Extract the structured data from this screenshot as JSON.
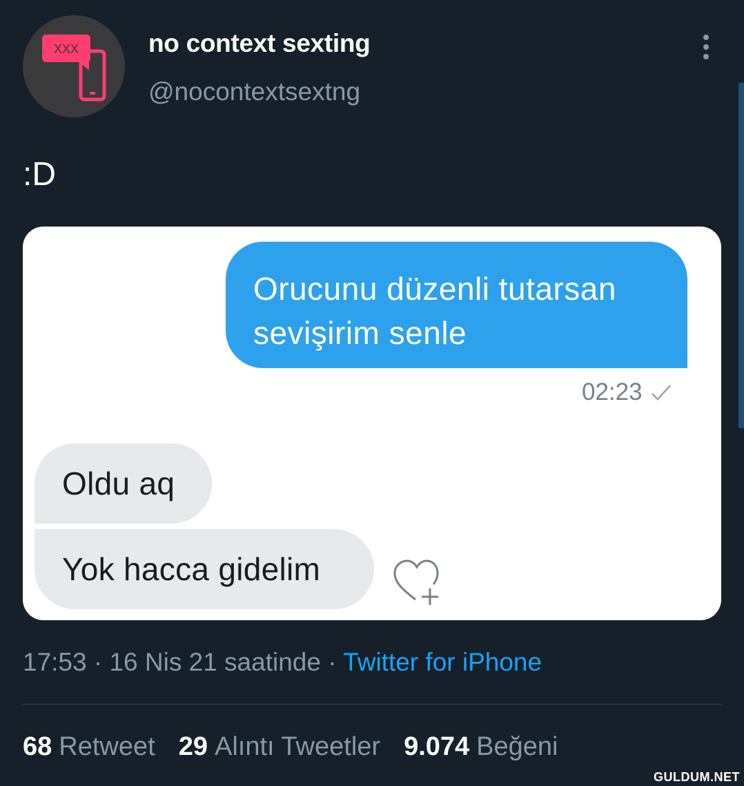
{
  "profile": {
    "avatar_badge_text": "XXX",
    "display_name": "no context sexting",
    "handle": "@nocontextsextng"
  },
  "tweet": {
    "text": ":D",
    "media": {
      "outgoing_message_line1": "Orucunu düzenli tutarsan",
      "outgoing_message_line2": "sevişirim senle",
      "outgoing_time": "02:23",
      "incoming_messages": [
        "Oldu aq",
        "Yok hacca gidelim"
      ]
    },
    "timestamp": "17:53 · 16 Nis 21 saatinde · ",
    "source": "Twitter for iPhone"
  },
  "stats": {
    "retweets_count": "68",
    "retweets_label": "Retweet",
    "quotes_count": "29",
    "quotes_label": "Alıntı Tweetler",
    "likes_count": "9.074",
    "likes_label": "Beğeni"
  },
  "watermark": "GULDUM.NET",
  "icons": [
    "more-vertical-icon",
    "read-check-icon",
    "heart-plus-icon",
    "phone-message-icon"
  ],
  "colors": {
    "background": "#15202b",
    "link": "#1da1f2",
    "outgoing_bubble": "#2ea1ec",
    "incoming_bubble": "#e7e9ed",
    "avatar_accent": "#ff3d6f"
  }
}
